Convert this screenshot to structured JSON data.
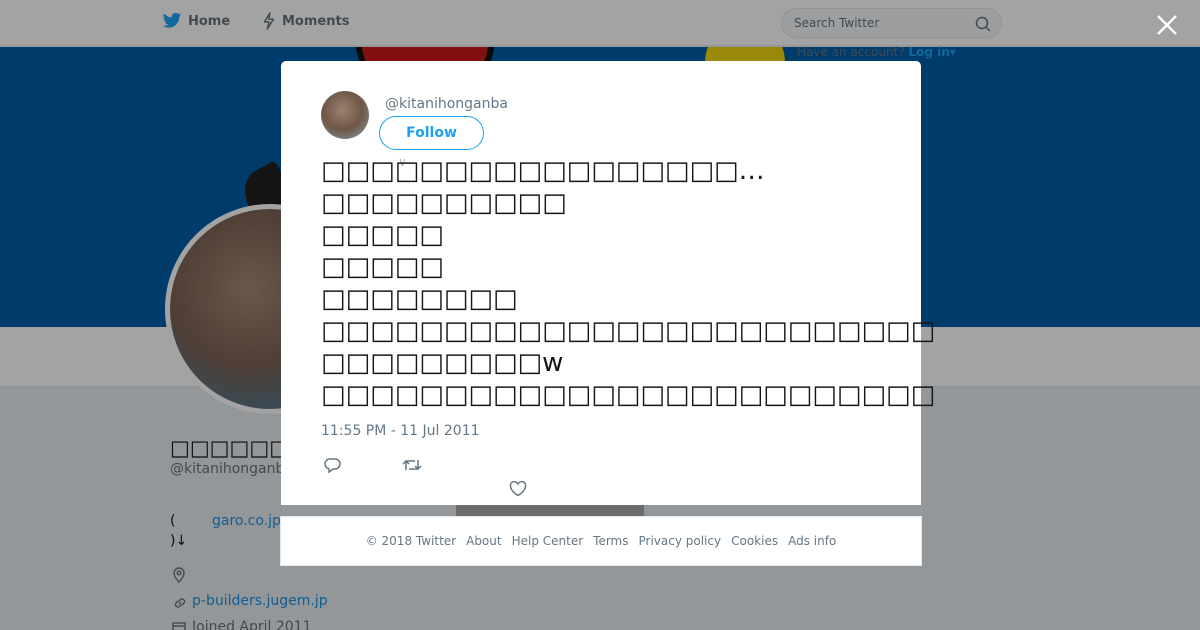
{
  "nav": {
    "home_label": "Home",
    "moments_label": "Moments"
  },
  "search": {
    "placeholder": "Search Twitter"
  },
  "account": {
    "prompt": "Have an account?",
    "login": "Log in"
  },
  "profile": {
    "name": "□□□□□□□□",
    "handle": "@kitanihonganba",
    "bio_open": "(",
    "bio_link": "garo.co.jp",
    "bio_close": ")↓",
    "website": "p-builders.jugem.jp",
    "joined": "Joined April 2011"
  },
  "tweet": {
    "handle": "@kitanihonganba",
    "follow_label": "Follow",
    "caret": "∨",
    "text": "□□□□□□□□□□□□□□□□□…\n□□□□□□□□□□\n□□□□□\n□□□□□\n□□□□□□□□\n□□□□□□□□□□□□□□□□□□□□□□□□□\n□□□□□□□□□w\n□□□□□□□□□□□□□□□□□□□□□□□□□",
    "timestamp": "11:55 PM - 11 Jul 2011"
  },
  "footer": {
    "links": [
      "© 2018 Twitter",
      "About",
      "Help Center",
      "Terms",
      "Privacy policy",
      "Cookies",
      "Ads info"
    ]
  },
  "colors": {
    "brand": "#1da1f2",
    "banner": "#005ea8",
    "link": "#1b95e0"
  },
  "icons": [
    "twitter-bird-icon",
    "lightning-icon",
    "search-icon",
    "close-icon",
    "location-icon",
    "link-icon",
    "calendar-icon",
    "reply-icon",
    "retweet-icon",
    "heart-icon"
  ]
}
